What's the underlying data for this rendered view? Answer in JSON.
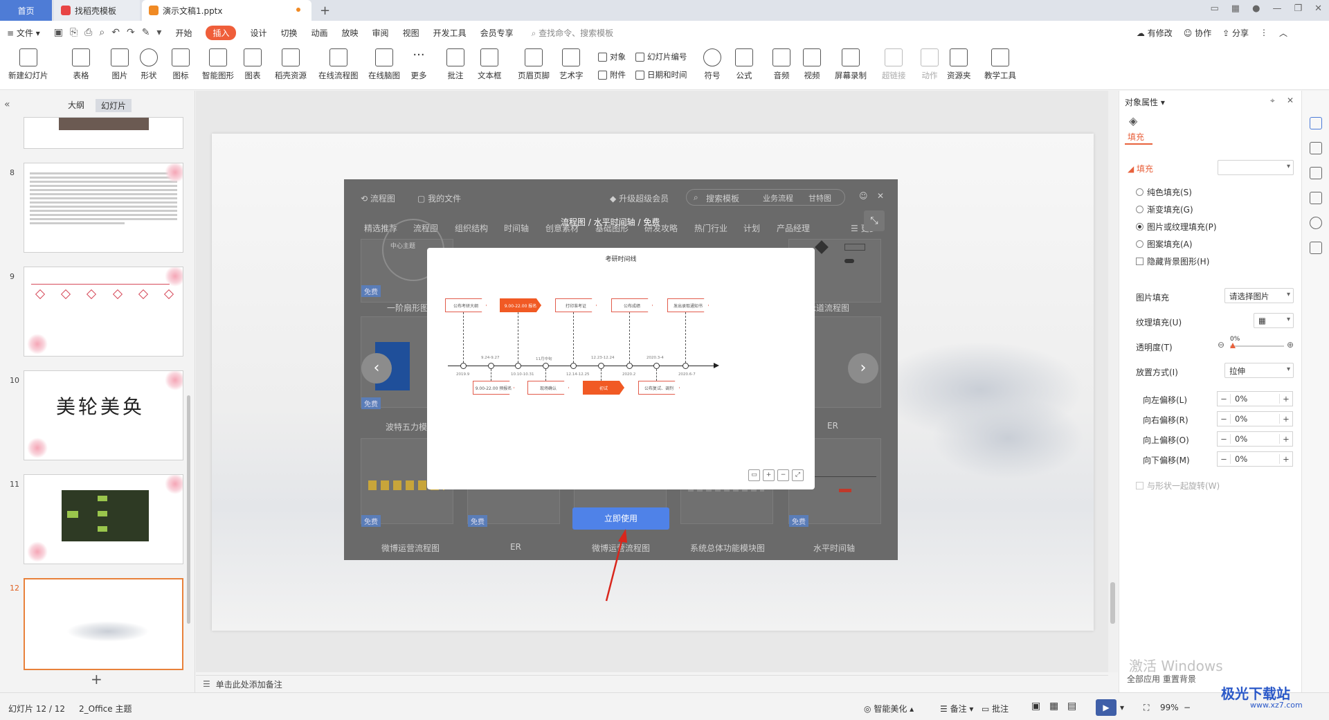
{
  "tabs": {
    "home": "首页",
    "template": "找稻壳模板",
    "document": "演示文稿1.pptx",
    "add": "+"
  },
  "menu": {
    "file": "文件",
    "items": [
      "开始",
      "插入",
      "设计",
      "切换",
      "动画",
      "放映",
      "审阅",
      "视图",
      "开发工具",
      "会员专享"
    ],
    "active": "插入",
    "search": "查找命令、搜索模板",
    "modified": "有修改",
    "collab": "协作",
    "share": "分享"
  },
  "ribbon": {
    "new_slide": "新建幻灯片",
    "table": "表格",
    "picture": "图片",
    "shape": "形状",
    "icon": "图标",
    "smart": "智能图形",
    "chart": "图表",
    "docer": "稻壳资源",
    "flow": "在线流程图",
    "mind": "在线脑图",
    "more": "更多",
    "comment": "批注",
    "textbox": "文本框",
    "header": "页眉页脚",
    "art": "艺术字",
    "object": "对象",
    "attach": "附件",
    "slide_no": "幻灯片编号",
    "datetime": "日期和时间",
    "symbol": "符号",
    "formula": "公式",
    "audio": "音频",
    "video": "视频",
    "record": "屏幕录制",
    "hyperlink": "超链接",
    "action": "动作",
    "resource": "资源夹",
    "teach": "教学工具"
  },
  "left": {
    "outline": "大纲",
    "slides": "幻灯片",
    "numbers": [
      "8",
      "9",
      "10",
      "11",
      "12"
    ],
    "slide10_text": "美轮美奂",
    "add": "+"
  },
  "notes": "单击此处添加备注",
  "dialog": {
    "tab_flow": "流程图",
    "tab_myfile": "我的文件",
    "upgrade": "升级超级会员",
    "search": "搜索模板",
    "s1": "业务流程",
    "s2": "甘特图",
    "cats": [
      "精选推荐",
      "流程图",
      "组织结构",
      "时间轴",
      "创意素材",
      "基础图形",
      "研发攻略",
      "热门行业",
      "计划",
      "产品经理"
    ],
    "more": "更多",
    "free": "免费",
    "cards": [
      "一阶扇形图",
      "泳道流程图",
      "波特五力模型",
      "ER",
      "微博运营流程图",
      "ER",
      "微博运营流程图",
      "系统总体功能模块图",
      "水平时间轴"
    ],
    "path": "流程图 / 水平时间轴 / 免费",
    "use": "立即使用",
    "center_label": "中心主题"
  },
  "timeline": {
    "title": "考研时间线",
    "top": [
      {
        "label": "公布考研大纲",
        "date": "2019.9",
        "hot": false
      },
      {
        "label": "9.00-22.00 报名",
        "date": "10.10-10.31",
        "hot": true
      },
      {
        "label": "打印准考证",
        "date": "12.14-12.25",
        "hot": false
      },
      {
        "label": "公布成绩",
        "date": "2020.2",
        "hot": false
      },
      {
        "label": "发出录取通知书",
        "date": "2020.6-7",
        "hot": false
      }
    ],
    "bottom": [
      {
        "label": "9.00-22.00 预报名",
        "date": "9.24-9.27",
        "hot": false
      },
      {
        "label": "现场确认",
        "date": "11月中旬",
        "hot": false
      },
      {
        "label": "初试",
        "date": "12.23-12.24",
        "hot": true
      },
      {
        "label": "公布复试、调剂",
        "date": "2020.3-4",
        "hot": false
      }
    ]
  },
  "right": {
    "title": "对象属性",
    "fill_tab": "填充",
    "section": "填充",
    "opt": [
      "纯色填充(S)",
      "渐变填充(G)",
      "图片或纹理填充(P)",
      "图案填充(A)"
    ],
    "hide_bg": "隐藏背景图形(H)",
    "pic_fill": "图片填充",
    "pic_fill_val": "请选择图片",
    "texture": "纹理填充(U)",
    "transparency": "透明度(T)",
    "trans_val": "0%",
    "place": "放置方式(I)",
    "place_val": "拉伸",
    "offsets": [
      {
        "label": "向左偏移(L)",
        "val": "0%"
      },
      {
        "label": "向右偏移(R)",
        "val": "0%"
      },
      {
        "label": "向上偏移(O)",
        "val": "0%"
      },
      {
        "label": "向下偏移(M)",
        "val": "0%"
      }
    ],
    "rotate": "与形状一起旋转(W)"
  },
  "status": {
    "slide": "幻灯片 12 / 12",
    "theme": "2_Office 主题",
    "beautify": "智能美化",
    "notes": "备注",
    "comment": "批注",
    "zoom": "99%"
  },
  "watermark": {
    "line1": "激活 Windows",
    "line2": "全部应用 重置背景",
    "brand": "极光下载站",
    "url": "www.xz7.com"
  },
  "colors": {
    "accent": "#ef5e3a",
    "blue": "#4f82e8"
  }
}
